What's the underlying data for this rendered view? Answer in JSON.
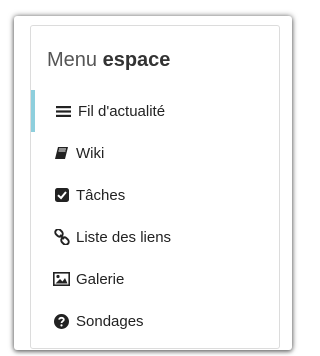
{
  "panel": {
    "title_light": "Menu",
    "title_bold": "espace"
  },
  "menu": {
    "items": [
      {
        "label": "Fil d'actualité",
        "icon": "list-icon",
        "active": true
      },
      {
        "label": "Wiki",
        "icon": "book-icon",
        "active": false
      },
      {
        "label": "Tâches",
        "icon": "check-square-icon",
        "active": false
      },
      {
        "label": "Liste des liens",
        "icon": "link-icon",
        "active": false
      },
      {
        "label": "Galerie",
        "icon": "image-icon",
        "active": false
      },
      {
        "label": "Sondages",
        "icon": "question-circle-icon",
        "active": false
      }
    ]
  },
  "colors": {
    "active_indicator": "#8ecfdd",
    "text": "#222222",
    "title": "#555555"
  }
}
